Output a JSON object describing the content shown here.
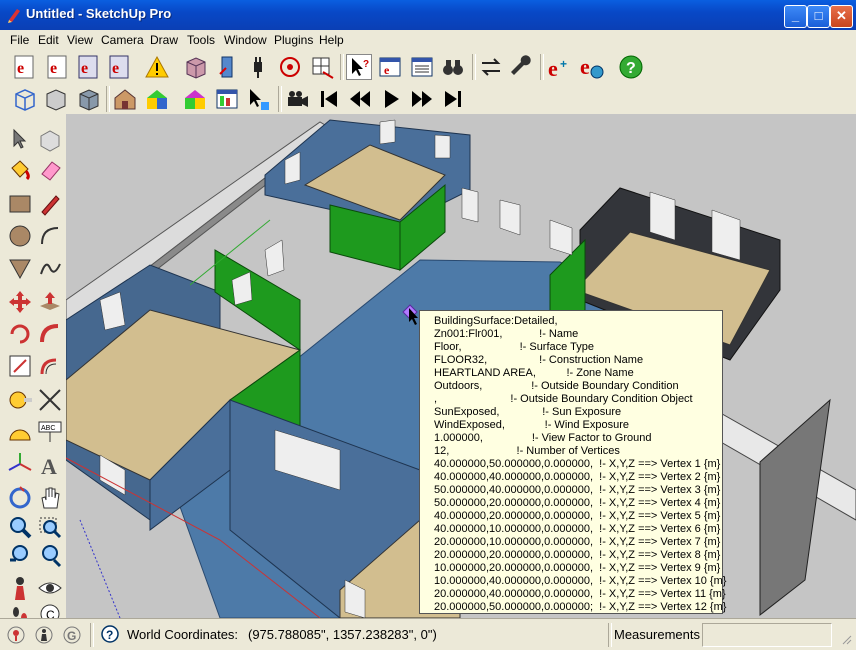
{
  "window": {
    "title": "Untitled - SketchUp Pro",
    "minimize": "_",
    "maximize": "□",
    "close": "✕"
  },
  "menu": [
    "File",
    "Edit",
    "View",
    "Camera",
    "Draw",
    "Tools",
    "Window",
    "Plugins",
    "Help"
  ],
  "tooltip": {
    "lines": [
      "BuildingSurface:Detailed,",
      "Zn001:Flr001,            !- Name",
      "Floor,                   !- Surface Type",
      "FLOOR32,                 !- Construction Name",
      "HEARTLAND AREA,          !- Zone Name",
      "Outdoors,                !- Outside Boundary Condition",
      ",                        !- Outside Boundary Condition Object",
      "SunExposed,              !- Sun Exposure",
      "WindExposed,             !- Wind Exposure",
      "1.000000,                !- View Factor to Ground",
      "12,                      !- Number of Vertices",
      "40.000000,50.000000,0.000000,  !- X,Y,Z ==> Vertex 1 {m}",
      "40.000000,40.000000,0.000000,  !- X,Y,Z ==> Vertex 2 {m}",
      "50.000000,40.000000,0.000000,  !- X,Y,Z ==> Vertex 3 {m}",
      "50.000000,20.000000,0.000000,  !- X,Y,Z ==> Vertex 4 {m}",
      "40.000000,20.000000,0.000000,  !- X,Y,Z ==> Vertex 5 {m}",
      "40.000000,10.000000,0.000000,  !- X,Y,Z ==> Vertex 6 {m}",
      "20.000000,10.000000,0.000000,  !- X,Y,Z ==> Vertex 7 {m}",
      "20.000000,20.000000,0.000000,  !- X,Y,Z ==> Vertex 8 {m}",
      "10.000000,20.000000,0.000000,  !- X,Y,Z ==> Vertex 9 {m}",
      "10.000000,40.000000,0.000000,  !- X,Y,Z ==> Vertex 10 {m}",
      "20.000000,40.000000,0.000000,  !- X,Y,Z ==> Vertex 11 {m}",
      "20.000000,50.000000,0.000000;  !- X,Y,Z ==> Vertex 12 {m}"
    ]
  },
  "status": {
    "coords_label": "World Coordinates:",
    "coords_value": "(975.788085\", 1357.238283\", 0\")",
    "measurements_label": "Measurements",
    "measurements_value": ""
  },
  "colors": {
    "titlebar": "#0a4fd6",
    "wall": "#4a6f9a",
    "floor": "#4d7aa8",
    "roof": "#d2be8f",
    "green": "#1e9a1e",
    "tooltip": "#ffffe1"
  }
}
